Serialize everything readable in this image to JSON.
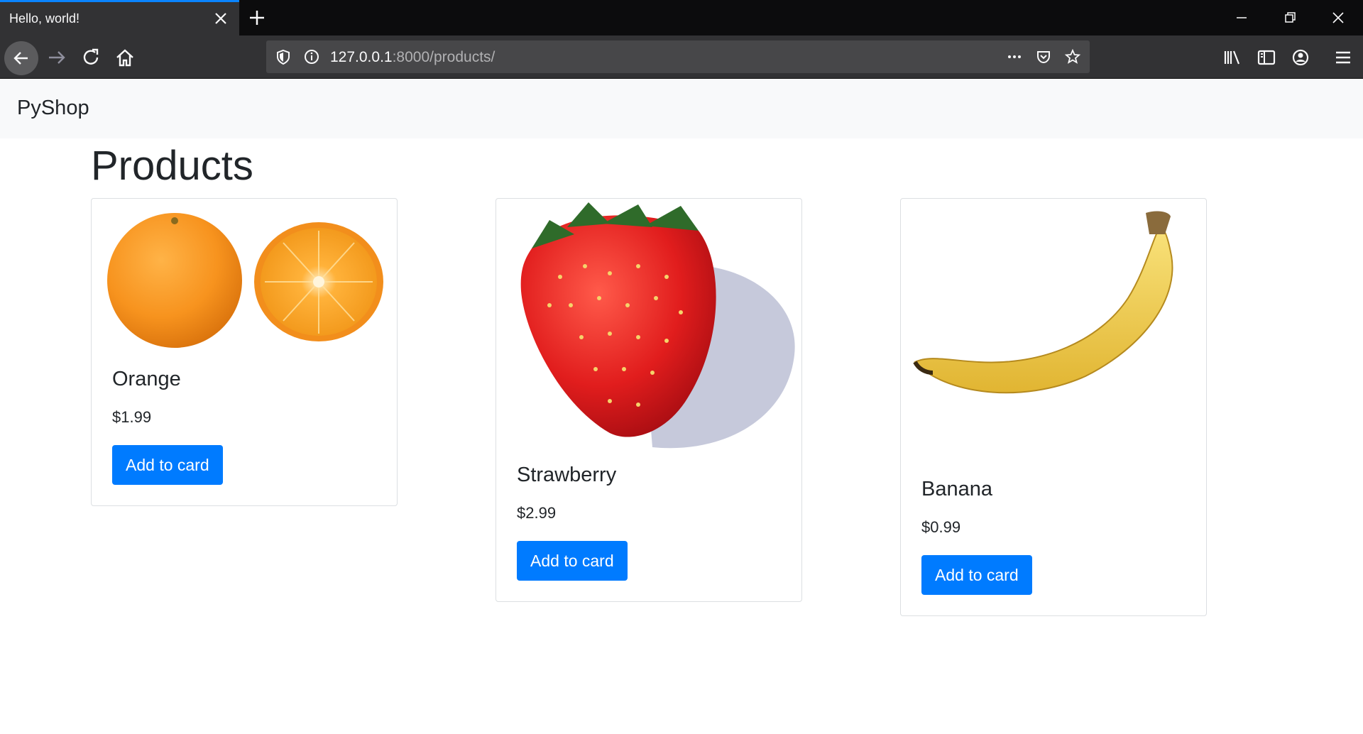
{
  "browser": {
    "tab_title": "Hello, world!",
    "url_host": "127.0.0.1",
    "url_rest": ":8000/products/",
    "accent": "#0a84ff"
  },
  "site": {
    "brand": "PyShop",
    "page_title": "Products",
    "button_color": "#007bff"
  },
  "products": [
    {
      "name": "Orange",
      "price": "$1.99",
      "button": "Add to card",
      "image": "orange-image"
    },
    {
      "name": "Strawberry",
      "price": "$2.99",
      "button": "Add to card",
      "image": "strawberry-image"
    },
    {
      "name": "Banana",
      "price": "$0.99",
      "button": "Add to card",
      "image": "banana-image"
    }
  ]
}
